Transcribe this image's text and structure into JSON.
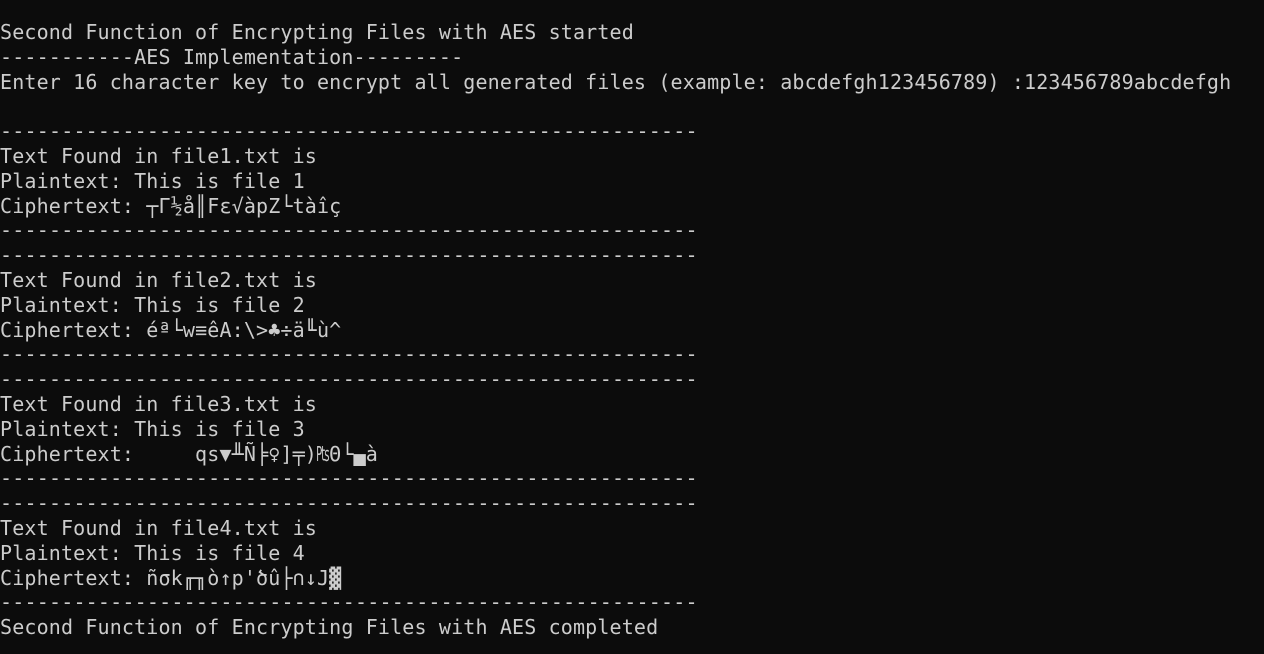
{
  "console": {
    "lines": [
      "Second Function of Encrypting Files with AES started",
      "-----------AES Implementation---------",
      "Enter 16 character key to encrypt all generated files (example: abcdefgh123456789) :123456789abcdefgh",
      "",
      "---------------------------------------------------------",
      "Text Found in file1.txt is",
      "Plaintext: This is file 1",
      "Ciphertext: ┬Γ½å║Fε√àpZ└tàîç",
      "---------------------------------------------------------",
      "---------------------------------------------------------",
      "Text Found in file2.txt is",
      "Plaintext: This is file 2",
      "Ciphertext: éª└w≡êA:\\>♣÷ä╙ù^",
      "---------------------------------------------------------",
      "---------------------------------------------------------",
      "Text Found in file3.txt is",
      "Plaintext: This is file 3",
      "Ciphertext:     qs▼╨Ñ╞♀]╤)₧Θ└▄à",
      "---------------------------------------------------------",
      "---------------------------------------------------------",
      "Text Found in file4.txt is",
      "Plaintext: This is file 4",
      "Ciphertext: ñσk╓╖ò↑p'ծû├∩↓J▓",
      "---------------------------------------------------------",
      "Second Function of Encrypting Files with AES completed"
    ]
  },
  "colors": {
    "background": "#0c0c0c",
    "text": "#cccccc"
  }
}
